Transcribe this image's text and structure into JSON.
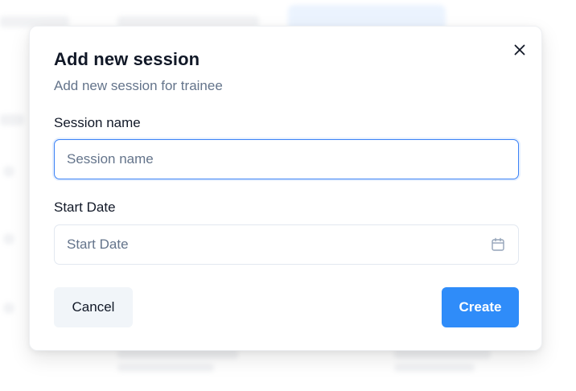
{
  "modal": {
    "title": "Add new session",
    "subtitle": "Add new session for trainee",
    "close_icon": "close-icon"
  },
  "form": {
    "session_name": {
      "label": "Session name",
      "placeholder": "Session name",
      "value": ""
    },
    "start_date": {
      "label": "Start Date",
      "placeholder": "Start Date",
      "value": "",
      "icon": "calendar-icon"
    }
  },
  "actions": {
    "cancel_label": "Cancel",
    "create_label": "Create"
  },
  "colors": {
    "accent": "#2f8cf9",
    "focus_border": "#3b82f6",
    "muted_text": "#64748b",
    "cancel_bg": "#f1f5f9"
  }
}
